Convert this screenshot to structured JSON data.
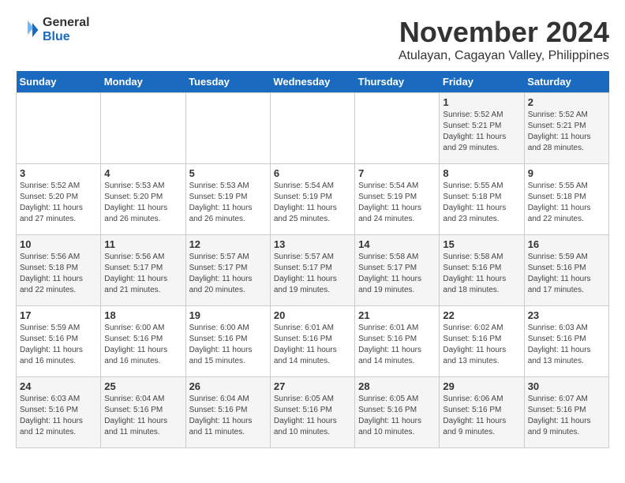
{
  "logo": {
    "general": "General",
    "blue": "Blue"
  },
  "title": "November 2024",
  "subtitle": "Atulayan, Cagayan Valley, Philippines",
  "days_header": [
    "Sunday",
    "Monday",
    "Tuesday",
    "Wednesday",
    "Thursday",
    "Friday",
    "Saturday"
  ],
  "weeks": [
    [
      {
        "day": "",
        "info": ""
      },
      {
        "day": "",
        "info": ""
      },
      {
        "day": "",
        "info": ""
      },
      {
        "day": "",
        "info": ""
      },
      {
        "day": "",
        "info": ""
      },
      {
        "day": "1",
        "info": "Sunrise: 5:52 AM\nSunset: 5:21 PM\nDaylight: 11 hours and 29 minutes."
      },
      {
        "day": "2",
        "info": "Sunrise: 5:52 AM\nSunset: 5:21 PM\nDaylight: 11 hours and 28 minutes."
      }
    ],
    [
      {
        "day": "3",
        "info": "Sunrise: 5:52 AM\nSunset: 5:20 PM\nDaylight: 11 hours and 27 minutes."
      },
      {
        "day": "4",
        "info": "Sunrise: 5:53 AM\nSunset: 5:20 PM\nDaylight: 11 hours and 26 minutes."
      },
      {
        "day": "5",
        "info": "Sunrise: 5:53 AM\nSunset: 5:19 PM\nDaylight: 11 hours and 26 minutes."
      },
      {
        "day": "6",
        "info": "Sunrise: 5:54 AM\nSunset: 5:19 PM\nDaylight: 11 hours and 25 minutes."
      },
      {
        "day": "7",
        "info": "Sunrise: 5:54 AM\nSunset: 5:19 PM\nDaylight: 11 hours and 24 minutes."
      },
      {
        "day": "8",
        "info": "Sunrise: 5:55 AM\nSunset: 5:18 PM\nDaylight: 11 hours and 23 minutes."
      },
      {
        "day": "9",
        "info": "Sunrise: 5:55 AM\nSunset: 5:18 PM\nDaylight: 11 hours and 22 minutes."
      }
    ],
    [
      {
        "day": "10",
        "info": "Sunrise: 5:56 AM\nSunset: 5:18 PM\nDaylight: 11 hours and 22 minutes."
      },
      {
        "day": "11",
        "info": "Sunrise: 5:56 AM\nSunset: 5:17 PM\nDaylight: 11 hours and 21 minutes."
      },
      {
        "day": "12",
        "info": "Sunrise: 5:57 AM\nSunset: 5:17 PM\nDaylight: 11 hours and 20 minutes."
      },
      {
        "day": "13",
        "info": "Sunrise: 5:57 AM\nSunset: 5:17 PM\nDaylight: 11 hours and 19 minutes."
      },
      {
        "day": "14",
        "info": "Sunrise: 5:58 AM\nSunset: 5:17 PM\nDaylight: 11 hours and 19 minutes."
      },
      {
        "day": "15",
        "info": "Sunrise: 5:58 AM\nSunset: 5:16 PM\nDaylight: 11 hours and 18 minutes."
      },
      {
        "day": "16",
        "info": "Sunrise: 5:59 AM\nSunset: 5:16 PM\nDaylight: 11 hours and 17 minutes."
      }
    ],
    [
      {
        "day": "17",
        "info": "Sunrise: 5:59 AM\nSunset: 5:16 PM\nDaylight: 11 hours and 16 minutes."
      },
      {
        "day": "18",
        "info": "Sunrise: 6:00 AM\nSunset: 5:16 PM\nDaylight: 11 hours and 16 minutes."
      },
      {
        "day": "19",
        "info": "Sunrise: 6:00 AM\nSunset: 5:16 PM\nDaylight: 11 hours and 15 minutes."
      },
      {
        "day": "20",
        "info": "Sunrise: 6:01 AM\nSunset: 5:16 PM\nDaylight: 11 hours and 14 minutes."
      },
      {
        "day": "21",
        "info": "Sunrise: 6:01 AM\nSunset: 5:16 PM\nDaylight: 11 hours and 14 minutes."
      },
      {
        "day": "22",
        "info": "Sunrise: 6:02 AM\nSunset: 5:16 PM\nDaylight: 11 hours and 13 minutes."
      },
      {
        "day": "23",
        "info": "Sunrise: 6:03 AM\nSunset: 5:16 PM\nDaylight: 11 hours and 13 minutes."
      }
    ],
    [
      {
        "day": "24",
        "info": "Sunrise: 6:03 AM\nSunset: 5:16 PM\nDaylight: 11 hours and 12 minutes."
      },
      {
        "day": "25",
        "info": "Sunrise: 6:04 AM\nSunset: 5:16 PM\nDaylight: 11 hours and 11 minutes."
      },
      {
        "day": "26",
        "info": "Sunrise: 6:04 AM\nSunset: 5:16 PM\nDaylight: 11 hours and 11 minutes."
      },
      {
        "day": "27",
        "info": "Sunrise: 6:05 AM\nSunset: 5:16 PM\nDaylight: 11 hours and 10 minutes."
      },
      {
        "day": "28",
        "info": "Sunrise: 6:05 AM\nSunset: 5:16 PM\nDaylight: 11 hours and 10 minutes."
      },
      {
        "day": "29",
        "info": "Sunrise: 6:06 AM\nSunset: 5:16 PM\nDaylight: 11 hours and 9 minutes."
      },
      {
        "day": "30",
        "info": "Sunrise: 6:07 AM\nSunset: 5:16 PM\nDaylight: 11 hours and 9 minutes."
      }
    ]
  ]
}
